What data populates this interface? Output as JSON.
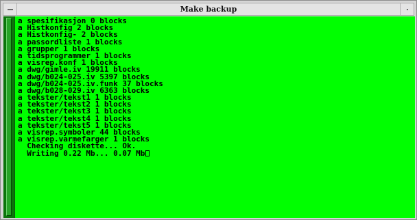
{
  "window": {
    "title": "Make backup",
    "menu_icon": "window-menu-icon",
    "maximize_icon": "maximize-icon"
  },
  "terminal": {
    "background_color": "#00ff00",
    "text_color": "#000000",
    "lines": [
      "a spesifikasjon 0 blocks",
      "a Histkonfig 2 blocks",
      "a Histkonfig- 2 blocks",
      "a passordliste 1 blocks",
      "a grupper 1 blocks",
      "a tidsprogrammer 1 blocks",
      "a visrep.konf 1 blocks",
      "a dwg/gimle.iv 19911 blocks",
      "a dwg/b024-025.iv 5397 blocks",
      "a dwg/b024-025.iv.funk 37 blocks",
      "a dwg/b028-029.iv 6363 blocks",
      "a tekster/tekst1 1 blocks",
      "a tekster/tekst2 1 blocks",
      "a tekster/tekst3 1 blocks",
      "a tekster/tekst4 1 blocks",
      "a tekster/tekst5 1 blocks",
      "a visrep.symboler 44 blocks",
      "a visrep.varmefarger 1 blocks",
      "  Checking diskette... Ok.",
      "  Writing 0.22 Mb... 0.07 Mb"
    ]
  }
}
